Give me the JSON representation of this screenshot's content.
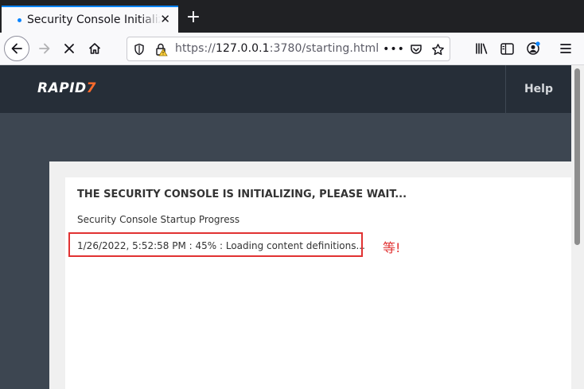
{
  "browser": {
    "tab": {
      "title": "Security Console Initializing"
    },
    "new_tab_label": "+",
    "url": {
      "scheme": "https://",
      "host": "127.0.0.1",
      "rest": ":3780/starting.html"
    },
    "icons": {
      "back": "back-arrow-icon",
      "forward": "forward-arrow-icon",
      "stop": "stop-icon",
      "home": "home-icon",
      "shield": "shield-icon",
      "lock": "insecure-lock-icon",
      "more": "more-dots-icon",
      "pocket": "pocket-icon",
      "bookmark": "star-icon",
      "library": "library-icon",
      "sidebar": "sidebar-icon",
      "account": "account-icon",
      "menu": "hamburger-menu-icon"
    },
    "accent_color": "#0a84ff"
  },
  "app": {
    "logo": {
      "main": "RAPID",
      "mark": "7"
    },
    "help_label": "Help",
    "title": "THE SECURITY CONSOLE IS INITIALIZING, PLEASE WAIT...",
    "subtitle": "Security Console Startup Progress",
    "progress_line": "1/26/2022, 5:52:58 PM : 45% : Loading content definitions...",
    "progress_percent": 45
  },
  "annotation": {
    "text": "等!",
    "color": "#e13232"
  }
}
